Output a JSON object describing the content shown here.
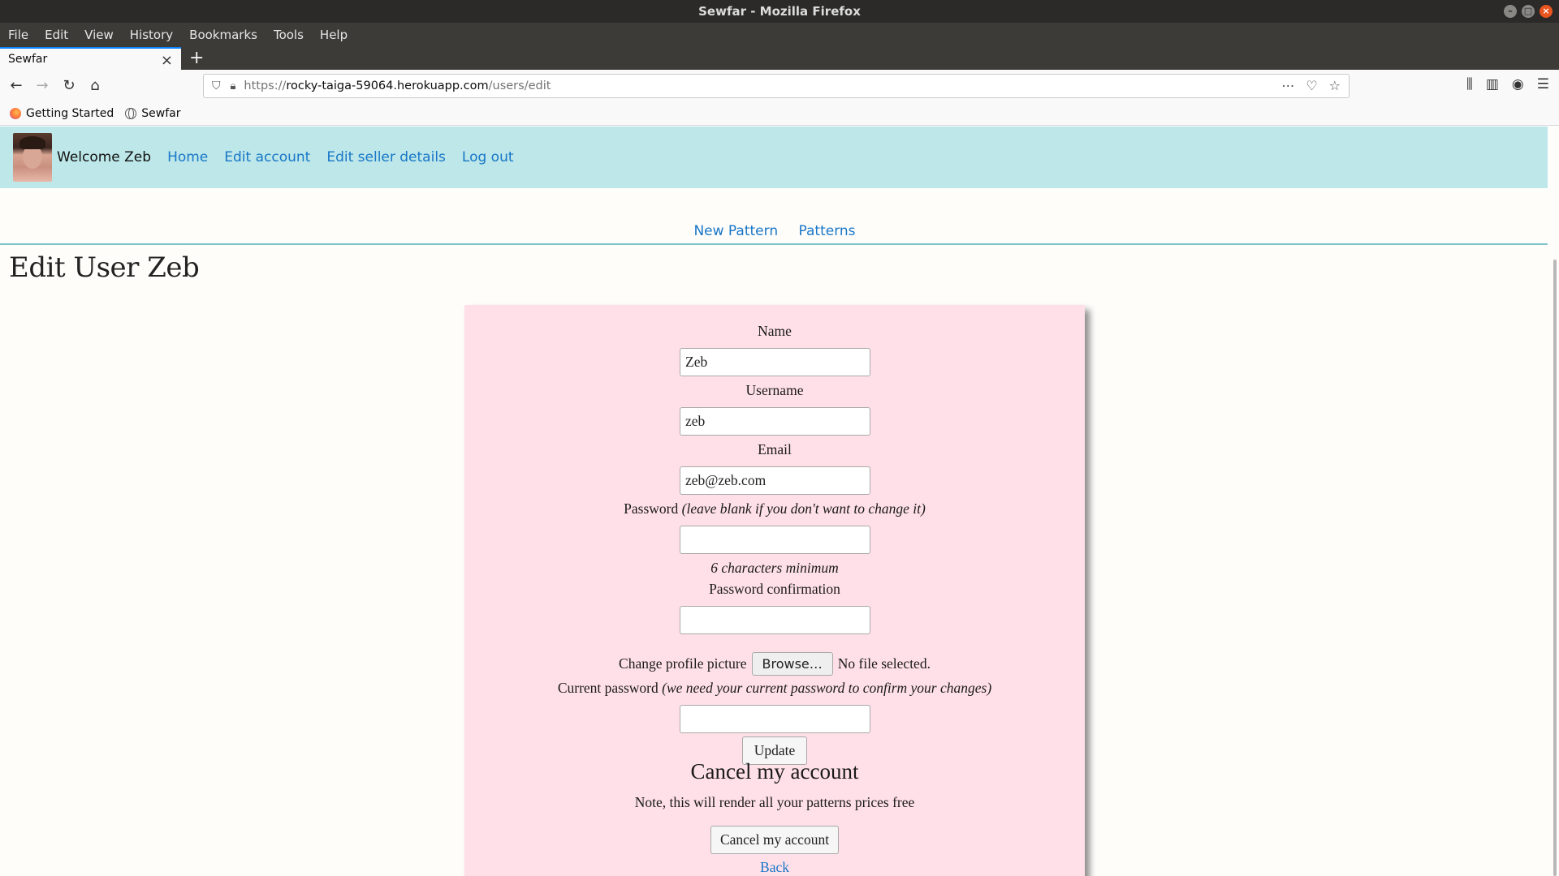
{
  "window": {
    "title": "Sewfar - Mozilla Firefox"
  },
  "menu": [
    "File",
    "Edit",
    "View",
    "History",
    "Bookmarks",
    "Tools",
    "Help"
  ],
  "tab": {
    "title": "Sewfar"
  },
  "urlbar": {
    "scheme": "https://",
    "host": "rocky-taiga-59064.herokuapp.com",
    "path": "/users/edit"
  },
  "bookmarks": [
    "Getting Started",
    "Sewfar"
  ],
  "site_nav": {
    "welcome": "Welcome Zeb",
    "links": [
      "Home",
      "Edit account",
      "Edit seller details",
      "Log out"
    ]
  },
  "sub_nav": {
    "links": [
      "New Pattern",
      "Patterns"
    ]
  },
  "page_title": "Edit User Zeb",
  "form": {
    "name_label": "Name",
    "name_value": "Zeb",
    "username_label": "Username",
    "username_value": "zeb",
    "email_label": "Email",
    "email_value": "zeb@zeb.com",
    "password_label": "Password",
    "password_hint": "(leave blank if you don't want to change it)",
    "password_value": "",
    "password_min": "6 characters minimum",
    "password_confirm_label": "Password confirmation",
    "password_confirm_value": "",
    "picture_label": "Change profile picture",
    "browse_label": "Browse…",
    "no_file": "No file selected.",
    "current_password_label": "Current password",
    "current_password_hint": "(we need your current password to confirm your changes)",
    "current_password_value": "",
    "update_label": "Update",
    "cancel_heading": "Cancel my account",
    "cancel_note": "Note, this will render all your patterns prices free",
    "cancel_button": "Cancel my account",
    "back_link": "Back"
  },
  "colors": {
    "nav_bg": "#bde7e8",
    "card_bg": "#ffe0e8",
    "link": "#1877c8",
    "accent_line": "#7fc2c9"
  }
}
